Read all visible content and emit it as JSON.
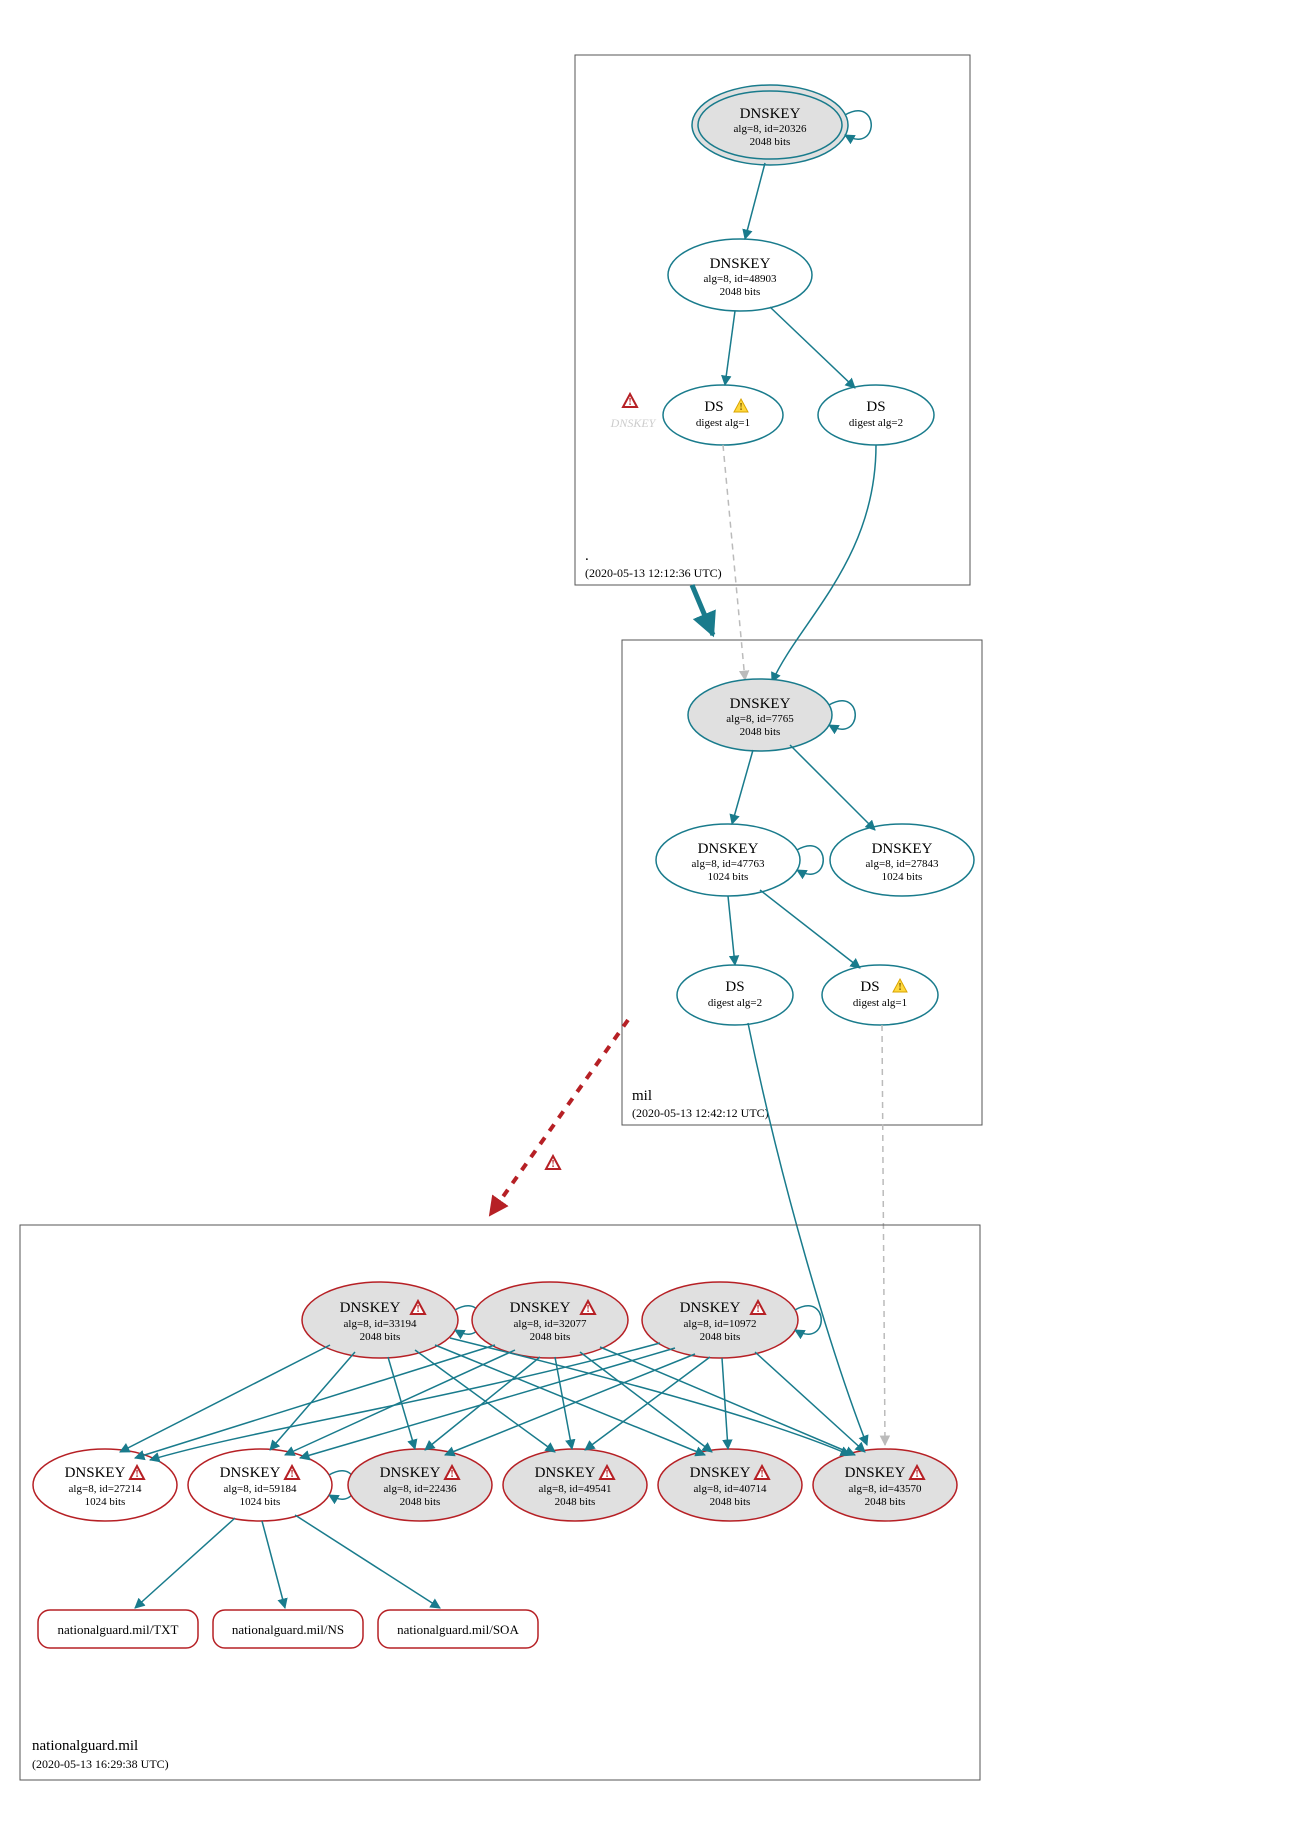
{
  "diagram": {
    "type": "dnssec-authentication-graph",
    "zones": [
      {
        "name": ".",
        "timestamp": "(2020-05-13 12:12:36 UTC)",
        "nodes": [
          {
            "id": "root-ksk",
            "type": "DNSKEY",
            "title": "DNSKEY",
            "sub1": "alg=8, id=20326",
            "sub2": "2048 bits",
            "fill": "grey",
            "trust_anchor": true
          },
          {
            "id": "root-zsk",
            "type": "DNSKEY",
            "title": "DNSKEY",
            "sub1": "alg=8, id=48903",
            "sub2": "2048 bits",
            "fill": "white"
          },
          {
            "id": "root-ds1",
            "type": "DS",
            "title": "DS",
            "sub1": "digest alg=1",
            "warn": "warning"
          },
          {
            "id": "root-ds2",
            "type": "DS",
            "title": "DS",
            "sub1": "digest alg=2"
          },
          {
            "id": "root-missing-dnskey",
            "type": "missing",
            "label": "DNSKEY",
            "warn": "error"
          }
        ]
      },
      {
        "name": "mil",
        "timestamp": "(2020-05-13 12:42:12 UTC)",
        "nodes": [
          {
            "id": "mil-ksk",
            "type": "DNSKEY",
            "title": "DNSKEY",
            "sub1": "alg=8, id=7765",
            "sub2": "2048 bits",
            "fill": "grey"
          },
          {
            "id": "mil-zsk1",
            "type": "DNSKEY",
            "title": "DNSKEY",
            "sub1": "alg=8, id=47763",
            "sub2": "1024 bits",
            "fill": "white"
          },
          {
            "id": "mil-zsk2",
            "type": "DNSKEY",
            "title": "DNSKEY",
            "sub1": "alg=8, id=27843",
            "sub2": "1024 bits",
            "fill": "white"
          },
          {
            "id": "mil-ds1",
            "type": "DS",
            "title": "DS",
            "sub1": "digest alg=2"
          },
          {
            "id": "mil-ds2",
            "type": "DS",
            "title": "DS",
            "sub1": "digest alg=1",
            "warn": "warning"
          }
        ]
      },
      {
        "name": "nationalguard.mil",
        "timestamp": "(2020-05-13 16:29:38 UTC)",
        "nodes": [
          {
            "id": "ng-k33194",
            "type": "DNSKEY",
            "title": "DNSKEY",
            "sub1": "alg=8, id=33194",
            "sub2": "2048 bits",
            "fill": "grey",
            "warn": "error"
          },
          {
            "id": "ng-k32077",
            "type": "DNSKEY",
            "title": "DNSKEY",
            "sub1": "alg=8, id=32077",
            "sub2": "2048 bits",
            "fill": "grey",
            "warn": "error"
          },
          {
            "id": "ng-k10972",
            "type": "DNSKEY",
            "title": "DNSKEY",
            "sub1": "alg=8, id=10972",
            "sub2": "2048 bits",
            "fill": "grey",
            "warn": "error"
          },
          {
            "id": "ng-k27214",
            "type": "DNSKEY",
            "title": "DNSKEY",
            "sub1": "alg=8, id=27214",
            "sub2": "1024 bits",
            "fill": "white",
            "warn": "error"
          },
          {
            "id": "ng-k59184",
            "type": "DNSKEY",
            "title": "DNSKEY",
            "sub1": "alg=8, id=59184",
            "sub2": "1024 bits",
            "fill": "white",
            "warn": "error"
          },
          {
            "id": "ng-k22436",
            "type": "DNSKEY",
            "title": "DNSKEY",
            "sub1": "alg=8, id=22436",
            "sub2": "2048 bits",
            "fill": "grey",
            "warn": "error"
          },
          {
            "id": "ng-k49541",
            "type": "DNSKEY",
            "title": "DNSKEY",
            "sub1": "alg=8, id=49541",
            "sub2": "2048 bits",
            "fill": "grey",
            "warn": "error"
          },
          {
            "id": "ng-k40714",
            "type": "DNSKEY",
            "title": "DNSKEY",
            "sub1": "alg=8, id=40714",
            "sub2": "2048 bits",
            "fill": "grey",
            "warn": "error"
          },
          {
            "id": "ng-k43570",
            "type": "DNSKEY",
            "title": "DNSKEY",
            "sub1": "alg=8, id=43570",
            "sub2": "2048 bits",
            "fill": "grey",
            "warn": "error"
          },
          {
            "id": "ng-txt",
            "type": "RR",
            "label": "nationalguard.mil/TXT"
          },
          {
            "id": "ng-ns",
            "type": "RR",
            "label": "nationalguard.mil/NS"
          },
          {
            "id": "ng-soa",
            "type": "RR",
            "label": "nationalguard.mil/SOA"
          }
        ]
      }
    ],
    "edges_note": "Teal solid arrows = secure delegation / signature. Grey dashed = insecure/weak digest path. Red dashed thick = delegation with errors. Self-loops on DNSKEYs indicate self-signature.",
    "warning_icons": {
      "warning": "yellow-triangle",
      "error": "red-triangle"
    }
  }
}
